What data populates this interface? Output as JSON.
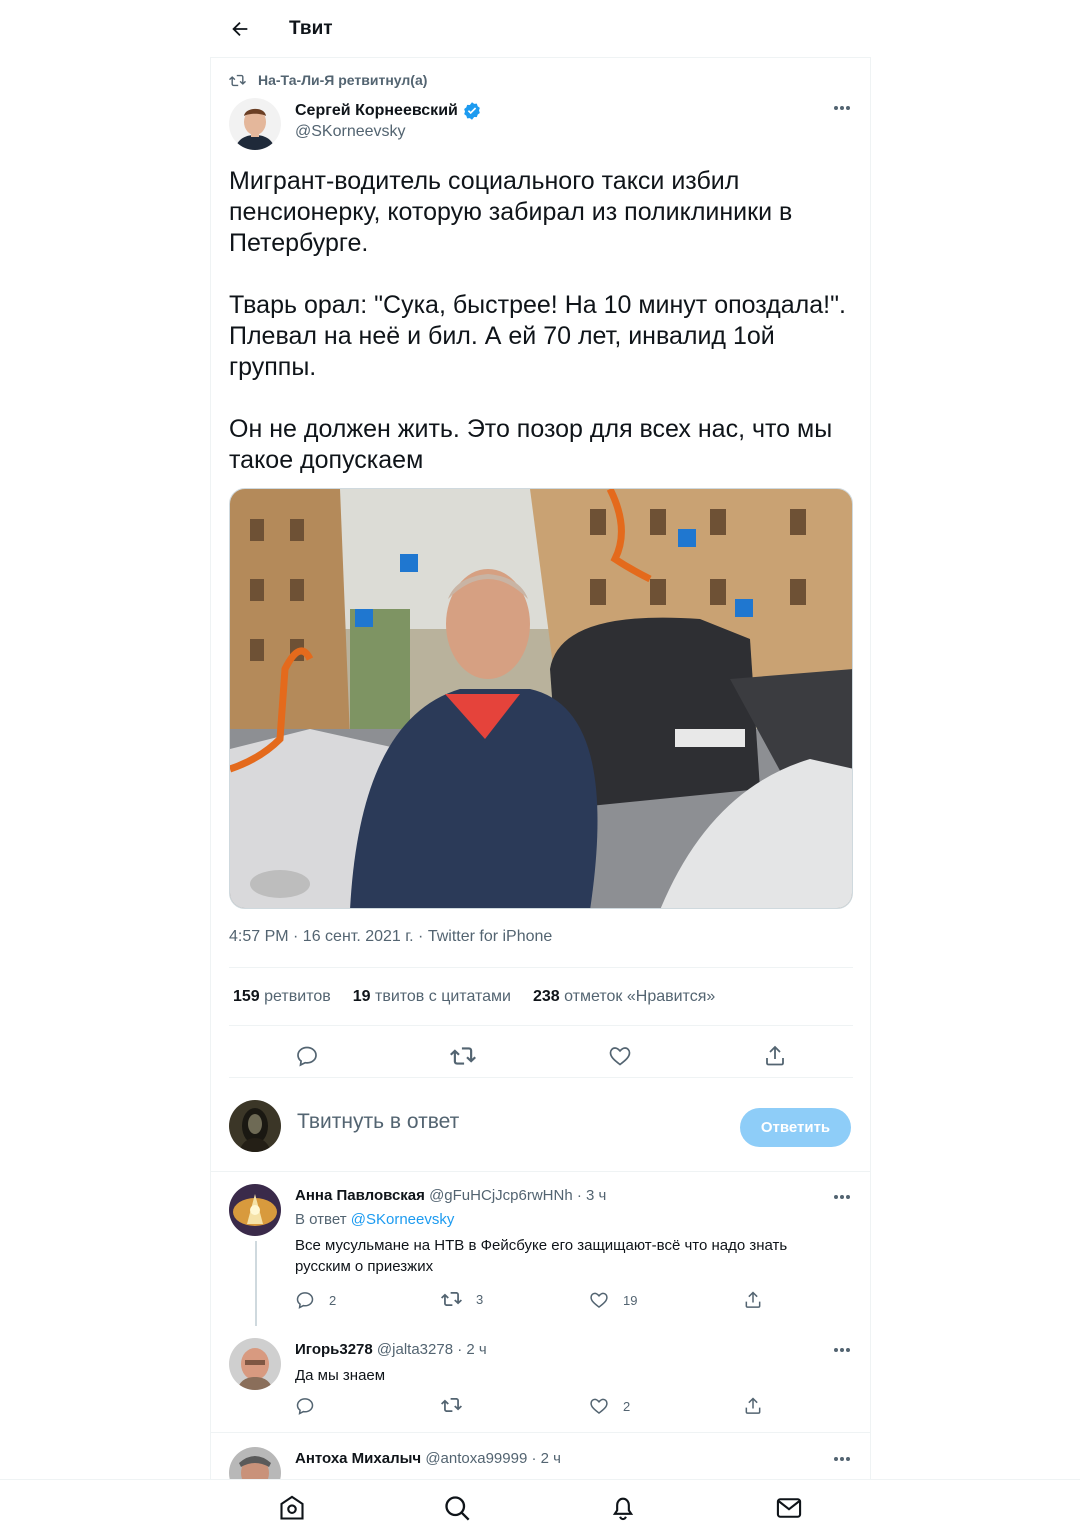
{
  "header": {
    "title": "Твит"
  },
  "retweet": {
    "label": "На-Та-Ли-Я ретвитнул(а)"
  },
  "author": {
    "name": "Сергей Корнеевский",
    "handle": "@SKorneevsky",
    "verified": true
  },
  "tweet": {
    "text": "Мигрант-водитель социального такси избил пенсионерку, которую забирал из поликлиники в Петербурге.\n\nТварь орал: \"Сука, быстрее! На 10 минут опоздала!\". Плевал на неё и бил. А ей 70 лет, инвалид 1ой группы.\n\nОн не должен жить. Это позор для всех нас, что мы такое допускаем",
    "meta": "4:57 PM · 16 сент. 2021 г. · Twitter for iPhone"
  },
  "stats": {
    "retweets_count": "159",
    "retweets_label": "ретвитов",
    "quotes_count": "19",
    "quotes_label": "твитов с цитатами",
    "likes_count": "238",
    "likes_label": "отметок «Нравится»"
  },
  "compose": {
    "placeholder": "Твитнуть в ответ",
    "button": "Ответить"
  },
  "replies": [
    {
      "name": "Анна Павловская",
      "handle": "@gFuHCjJcp6rwHNh",
      "time": "· 3 ч",
      "reply_to_prefix": "В ответ ",
      "reply_to_handle": "@SKorneevsky",
      "text": "Все   мусульмане на НТВ в Фейсбуке его  защищают-всё  что надо знать  русским о приезжих",
      "replies": "2",
      "retweets": "3",
      "likes": "19"
    },
    {
      "name": "Игорь3278",
      "handle": "@jalta3278",
      "time": "· 2 ч",
      "text": "Да мы знаем",
      "replies": "",
      "retweets": "",
      "likes": "2"
    },
    {
      "name": "Антоха Михалыч",
      "handle": "@antoxa99999",
      "time": "· 2 ч"
    }
  ],
  "colors": {
    "accent": "#1d9bf0",
    "button_disabled": "#8ecdf8",
    "muted": "#536471"
  },
  "icons": [
    "back-arrow-icon",
    "retweet-icon",
    "verified-badge-icon",
    "more-icon",
    "reply-icon",
    "like-icon",
    "share-icon",
    "home-icon",
    "search-icon",
    "bell-icon",
    "mail-icon"
  ]
}
